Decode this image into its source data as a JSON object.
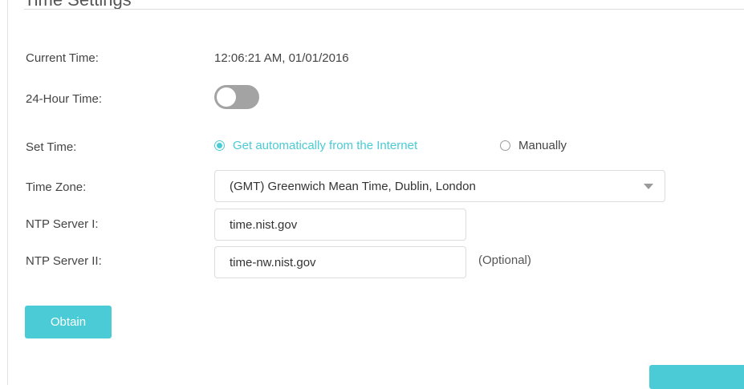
{
  "section": {
    "title": "Time Settings"
  },
  "current_time": {
    "label": "Current Time:",
    "value": "12:06:21 AM, 01/01/2016"
  },
  "hour24": {
    "label": "24-Hour Time:",
    "enabled": false
  },
  "set_time": {
    "label": "Set Time:",
    "options": [
      {
        "label": "Get automatically from the Internet",
        "selected": true
      },
      {
        "label": "Manually",
        "selected": false
      }
    ]
  },
  "time_zone": {
    "label": "Time Zone:",
    "selected": "(GMT) Greenwich Mean Time, Dublin, London"
  },
  "ntp1": {
    "label": "NTP Server I:",
    "value": "time.nist.gov"
  },
  "ntp2": {
    "label": "NTP Server II:",
    "value": "time-nw.nist.gov",
    "hint": "(Optional)"
  },
  "buttons": {
    "obtain": "Obtain",
    "save": ""
  },
  "colors": {
    "accent": "#4acbd6",
    "toggle_off": "#a3a3a3",
    "border": "#dcdcdc"
  },
  "icons": {
    "dropdown": "caret-down-icon"
  }
}
